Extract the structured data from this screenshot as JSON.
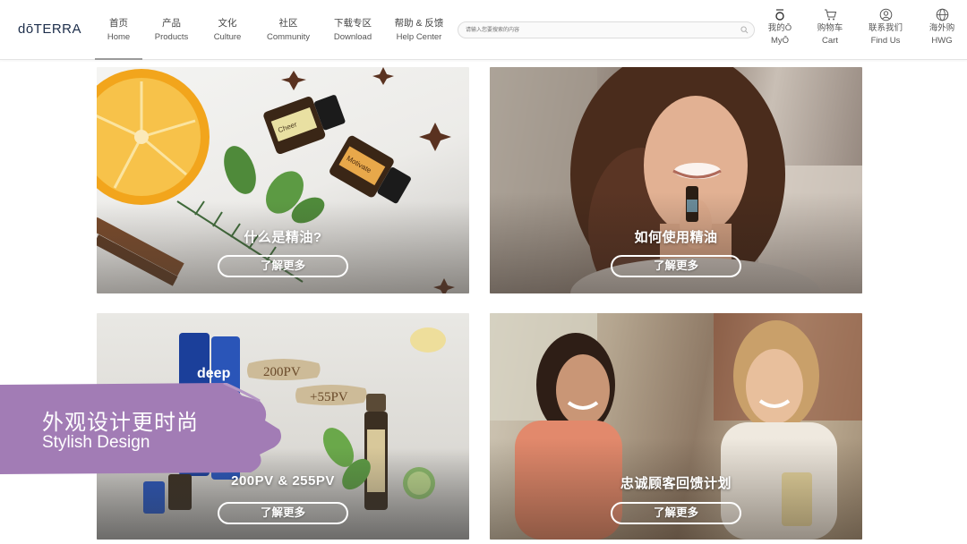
{
  "brand": {
    "logo_text": "dōTERRA"
  },
  "nav": {
    "items": [
      {
        "zh": "首页",
        "en": "Home"
      },
      {
        "zh": "产品",
        "en": "Products"
      },
      {
        "zh": "文化",
        "en": "Culture"
      },
      {
        "zh": "社区",
        "en": "Community"
      },
      {
        "zh": "下载专区",
        "en": "Download"
      },
      {
        "zh": "帮助 & 反馈",
        "en": "Help Center"
      }
    ],
    "active_index": 0
  },
  "search": {
    "placeholder": "请输入您要搜索的内容"
  },
  "utilities": [
    {
      "zh": "我的Ō",
      "en": "MyŌ",
      "icon": "myo-logo-icon"
    },
    {
      "zh": "购物车",
      "en": "Cart",
      "icon": "cart-icon"
    },
    {
      "zh": "联系我们",
      "en": "Find Us",
      "icon": "user-circle-icon"
    },
    {
      "zh": "海外购",
      "en": "HWG",
      "icon": "globe-icon"
    }
  ],
  "tiles": [
    {
      "title": "什么是精油?",
      "button": "了解更多"
    },
    {
      "title": "如何使用精油",
      "button": "了解更多"
    },
    {
      "title": "200PV & 255PV",
      "button": "了解更多"
    },
    {
      "title": "忠诚顾客回馈计划",
      "button": "了解更多"
    }
  ],
  "promo": {
    "zh": "外观设计更时尚",
    "en": "Stylish Design",
    "color": "#a27cb5"
  },
  "product_labels": {
    "pv_1": "200PV",
    "pv_2": "+55PV",
    "oil_1": "Cheer",
    "oil_2": "Motivate",
    "tube": "deep"
  }
}
